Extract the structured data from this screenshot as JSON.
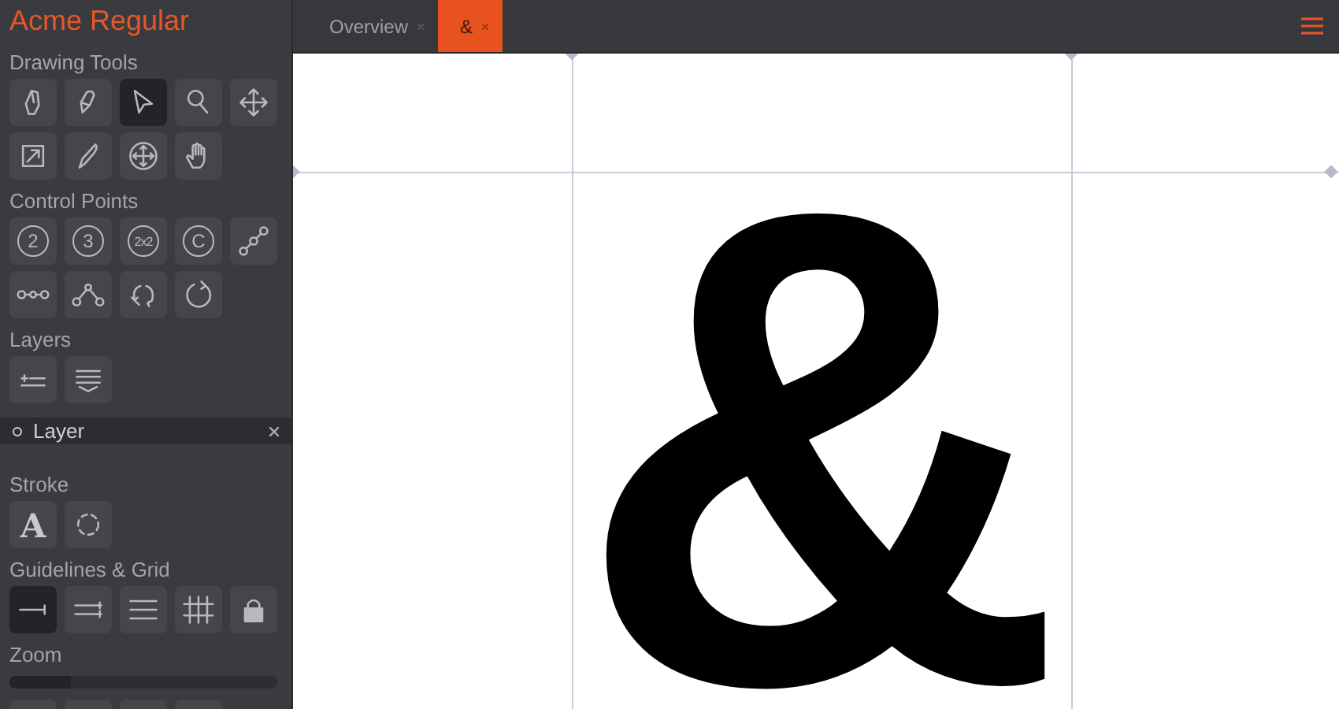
{
  "app": {
    "title": "Acme Regular"
  },
  "tabs": [
    {
      "label": "Overview",
      "selected": false
    },
    {
      "label": "&",
      "selected": true
    }
  ],
  "sections": [
    {
      "title": "Drawing Tools",
      "tools": [
        {
          "kind": "pen",
          "selected": false
        },
        {
          "kind": "pencil",
          "selected": false
        },
        {
          "kind": "pointer",
          "selected": true
        },
        {
          "kind": "magnifier",
          "selected": false
        },
        {
          "kind": "move",
          "selected": false
        },
        {
          "kind": "resize",
          "selected": false
        },
        {
          "kind": "knife",
          "selected": false
        },
        {
          "kind": "circle-move",
          "selected": false
        },
        {
          "kind": "hand",
          "selected": false
        }
      ]
    },
    {
      "title": "Control Points",
      "tools": [
        {
          "kind": "circled",
          "label": "2",
          "selected": false
        },
        {
          "kind": "circled",
          "label": "3",
          "selected": false
        },
        {
          "kind": "circled",
          "label": "2x2",
          "selected": false
        },
        {
          "kind": "circled",
          "label": "C",
          "selected": false
        },
        {
          "kind": "diagonal-nodes",
          "selected": false
        },
        {
          "kind": "line-nodes",
          "selected": false
        },
        {
          "kind": "peak-nodes",
          "selected": false
        },
        {
          "kind": "rotate",
          "selected": false
        },
        {
          "kind": "refresh",
          "selected": false
        }
      ]
    },
    {
      "title": "Layers",
      "tools": [
        {
          "kind": "add-layer",
          "selected": false
        },
        {
          "kind": "stack",
          "selected": false
        }
      ]
    }
  ],
  "layers": [
    {
      "name": "Layer"
    }
  ],
  "sections2": [
    {
      "title": "Stroke",
      "tools": [
        {
          "kind": "letter",
          "label": "A",
          "selected": false
        },
        {
          "kind": "dashed-circle",
          "selected": false
        }
      ]
    },
    {
      "title": "Guidelines & Grid",
      "tools": [
        {
          "kind": "one-line",
          "selected": true
        },
        {
          "kind": "two-lines",
          "selected": false
        },
        {
          "kind": "three-lines",
          "selected": false
        },
        {
          "kind": "grid",
          "selected": false
        },
        {
          "kind": "lock",
          "selected": false
        }
      ]
    },
    {
      "title": "Zoom"
    }
  ],
  "zoom": {
    "level": 0.23
  },
  "bottom_tools": [
    {
      "selected": false
    },
    {
      "selected": false
    },
    {
      "selected": false
    },
    {
      "selected": false
    }
  ],
  "glyph": {
    "character": "&"
  }
}
